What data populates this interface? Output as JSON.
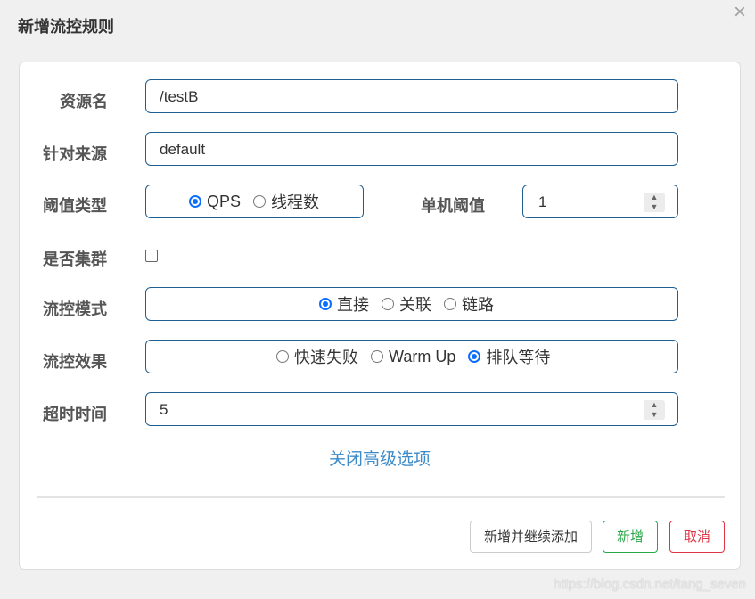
{
  "dialog": {
    "title": "新增流控规则",
    "close_glyph": "×"
  },
  "form": {
    "resource_name": {
      "label": "资源名",
      "value": "/testB"
    },
    "limit_app": {
      "label": "针对来源",
      "value": "default"
    },
    "threshold_type": {
      "label": "阈值类型",
      "options": [
        "QPS",
        "线程数"
      ],
      "selected": "QPS"
    },
    "single_threshold": {
      "label": "单机阈值",
      "value": "1"
    },
    "cluster_mode": {
      "label": "是否集群",
      "checked": false
    },
    "control_mode": {
      "label": "流控模式",
      "options": [
        "直接",
        "关联",
        "链路"
      ],
      "selected": "直接"
    },
    "control_effect": {
      "label": "流控效果",
      "options": [
        "快速失败",
        "Warm Up",
        "排队等待"
      ],
      "selected": "排队等待"
    },
    "timeout": {
      "label": "超时时间",
      "value": "5"
    },
    "advanced_link": "关闭高级选项"
  },
  "footer": {
    "add_continue": "新增并继续添加",
    "add": "新增",
    "cancel": "取消"
  },
  "watermark": "https://blog.csdn.net/tang_seven",
  "colors": {
    "accent": "#0d6efd",
    "border": "#1f5e91",
    "link": "#3d8bc9",
    "green": "#28a745",
    "red": "#dc3545"
  },
  "icons": {
    "spinner_up": "▲",
    "spinner_down": "▼"
  }
}
